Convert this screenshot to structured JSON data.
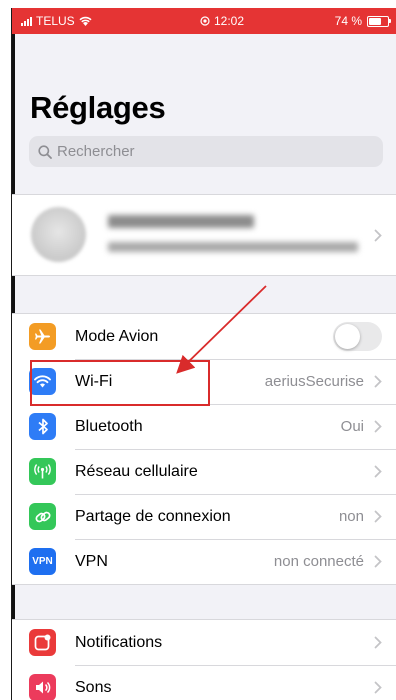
{
  "status_bar": {
    "carrier": "TELUS",
    "time": "12:02",
    "battery": "74 %",
    "battery_level": 0.74
  },
  "title": "Réglages",
  "search": {
    "placeholder": "Rechercher",
    "icon": "search-icon"
  },
  "profile": {
    "name": "Michel Goldine",
    "subtitle": "Identifiant Apple, iCloud, contenus et achats"
  },
  "rows_group1": [
    {
      "label": "Mode Avion",
      "icon": "airplane-icon",
      "color": "#f39c24",
      "toggle": false
    },
    {
      "label": "Wi-Fi",
      "icon": "wifi-icon",
      "color": "#2e7cf6",
      "value": "aeriusSecurise"
    },
    {
      "label": "Bluetooth",
      "icon": "bluetooth-icon",
      "color": "#2e7cf6",
      "value": "Oui"
    },
    {
      "label": "Réseau cellulaire",
      "icon": "antenna-icon",
      "color": "#34c759",
      "value": ""
    },
    {
      "label": "Partage de connexion",
      "icon": "link-icon",
      "color": "#34c759",
      "value": "non"
    },
    {
      "label": "VPN",
      "icon": "vpn-icon",
      "color": "#1e6ff0",
      "icon_text": "VPN",
      "value": "non connecté"
    }
  ],
  "rows_group2": [
    {
      "label": "Notifications",
      "icon": "notifications-icon",
      "color": "#ea3a3a"
    },
    {
      "label": "Sons",
      "icon": "speaker-icon",
      "color": "#ec3b5c"
    }
  ],
  "colors": {
    "status_bar": "#e53434",
    "annotation": "#d92b2b"
  }
}
